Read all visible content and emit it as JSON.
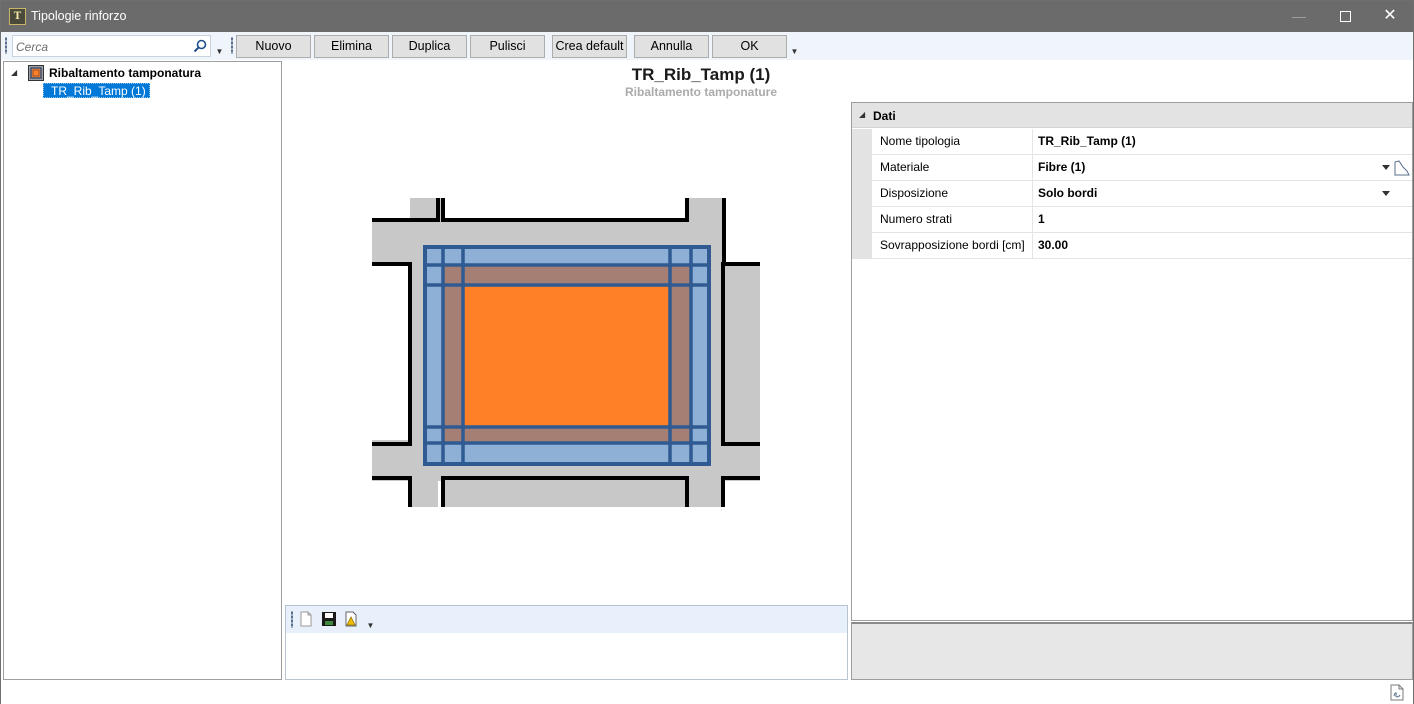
{
  "window": {
    "title": "Tipologie rinforzo",
    "icon_name": "app-logo-icon",
    "icon_text": "T"
  },
  "toolbar": {
    "search_placeholder": "Cerca",
    "buttons": [
      "Nuovo",
      "Elimina",
      "Duplica",
      "Pulisci",
      "Crea default",
      "Annulla",
      "OK"
    ]
  },
  "tree": {
    "root_label": "Ribaltamento tamponatura",
    "root_icon": "reinforcement-type-icon",
    "child_label": "TR_Rib_Tamp (1)"
  },
  "main": {
    "title": "TR_Rib_Tamp (1)",
    "subtitle": "Ribaltamento tamponature"
  },
  "properties": {
    "category": "Dati",
    "rows": [
      {
        "name": "Nome tipologia",
        "value": "TR_Rib_Tamp (1)"
      },
      {
        "name": "Materiale",
        "value": "Fibre (1)"
      },
      {
        "name": "Disposizione",
        "value": "Solo bordi"
      },
      {
        "name": "Numero strati",
        "value": "1"
      },
      {
        "name": "Sovrapposizione bordi [cm]",
        "value": "30.00"
      }
    ]
  },
  "colors": {
    "infill": "#ff8027",
    "fibre_strip": "#4f78b0",
    "masonry_frame": "#c8c8c8",
    "selection": "#0078d7"
  }
}
